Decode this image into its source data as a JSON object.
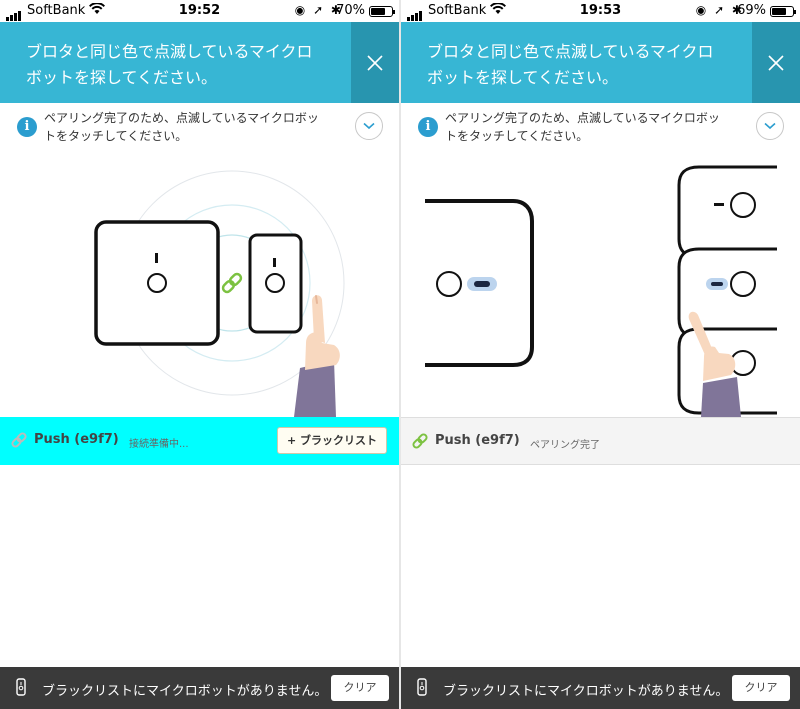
{
  "panels": [
    {
      "status": {
        "carrier": "SoftBank",
        "time": "19:52",
        "battery_pct": "70%",
        "battery_level": 0.7
      },
      "header": {
        "title": "ブロタと同じ色で点滅しているマイクロボットを探してください。",
        "close_icon": "close-x-icon"
      },
      "info": {
        "text": "ペアリング完了のため、点滅しているマイクロボットをタッチしてください。",
        "icon": "info-icon",
        "expand_icon": "chevron-down-icon"
      },
      "device": {
        "name": "Push (e9f7)",
        "status": "接続準備中...",
        "button_label": "+ ブラックリスト",
        "highlight_color": "#00ffff"
      },
      "bottom": {
        "message": "ブラックリストにマイクロボットがありません。",
        "clear_label": "クリア"
      }
    },
    {
      "status": {
        "carrier": "SoftBank",
        "time": "19:53",
        "battery_pct": "69%",
        "battery_level": 0.69
      },
      "header": {
        "title": "ブロタと同じ色で点滅しているマイクロボットを探してください。",
        "close_icon": "close-x-icon"
      },
      "info": {
        "text": "ペアリング完了のため、点滅しているマイクロボットをタッチしてください。",
        "icon": "info-icon",
        "expand_icon": "chevron-down-icon"
      },
      "device": {
        "name": "Push (e9f7)",
        "status": "ペアリング完了",
        "link_color": "#7cc241"
      },
      "bottom": {
        "message": "ブラックリストにマイクロボットがありません。",
        "clear_label": "クリア"
      }
    }
  ],
  "colors": {
    "header_bg": "#37b6d4",
    "header_close_bg": "#2895af",
    "info_icon": "#2b9dcf",
    "bottom_bar": "#3a3a3a",
    "link_green": "#7cc241"
  }
}
